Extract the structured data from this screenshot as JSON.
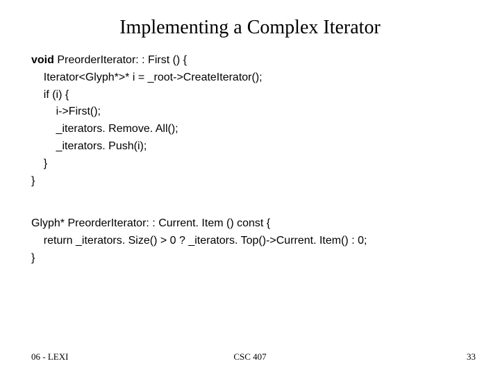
{
  "title": "Implementing a Complex Iterator",
  "code1": {
    "l1a": "void",
    "l1b": " PreorderIterator: : First () {",
    "l2": "    Iterator<Glyph*>* i = _root->CreateIterator();",
    "l3": "    if (i) {",
    "l4": "        i->First();",
    "l5": "        _iterators. Remove. All();",
    "l6": "        _iterators. Push(i);",
    "l7": "    }",
    "l8": "}"
  },
  "code2": {
    "l1": "Glyph* PreorderIterator: : Current. Item () const {",
    "l2": "    return _iterators. Size() > 0 ? _iterators. Top()->Current. Item() : 0;",
    "l3": "}"
  },
  "footer": {
    "left": "06 - LEXI",
    "center": "CSC 407",
    "right": "33"
  }
}
